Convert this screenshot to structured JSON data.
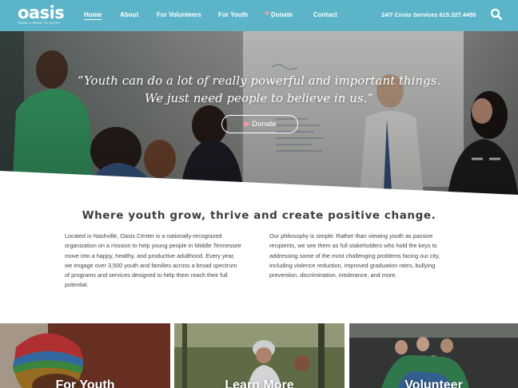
{
  "brand": {
    "name": "oasis",
    "tagline": "THERE'S MORE TO YOUTH",
    "primary_color": "#5cb4c9",
    "heart_color": "#f19aa3"
  },
  "nav": {
    "items": [
      {
        "label": "Home",
        "active": true
      },
      {
        "label": "About"
      },
      {
        "label": "For Volunteers"
      },
      {
        "label": "For Youth"
      },
      {
        "label": "Donate",
        "icon": "heart-icon"
      },
      {
        "label": "Contact"
      }
    ],
    "crisis": "24/7 Crisis Services 615.327.4455",
    "search_icon": "search-icon"
  },
  "hero": {
    "quote": "“Youth can do a lot of really powerful and important things. We just need people to believe in us.”",
    "donate_label": "Donate"
  },
  "intro": {
    "headline": "Where youth grow, thrive and create positive change.",
    "left": "Located in Nashville, Oasis Center is a nationally-recognized organization on a mission to help young people in Middle Tennessee move into a happy, healthy, and productive adulthood. Every year, we engage over 3,500 youth and families across a broad spectrum of programs and services designed to help them reach their full potential.",
    "right": "Our philosophy is simple: Rather than viewing youth as passive recipients, we see them as full stakeholders who hold the keys to addressing some of the most challenging problems facing our city, including violence reduction, improved graduation rates, bullying prevention, discrimination, intolerance, and more."
  },
  "cards": [
    {
      "label": "For Youth"
    },
    {
      "label": "Learn More"
    },
    {
      "label": "Volunteer"
    }
  ]
}
